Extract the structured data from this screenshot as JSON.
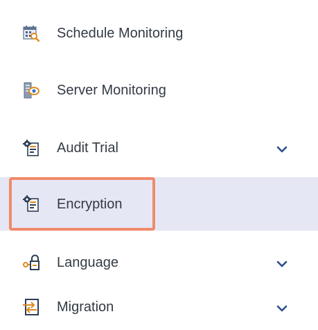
{
  "menu": {
    "items": [
      {
        "label": "Schedule Monitoring",
        "icon": "calendar-search-icon",
        "has_chevron": false,
        "selected": false
      },
      {
        "label": "Server Monitoring",
        "icon": "server-eye-icon",
        "has_chevron": false,
        "selected": false
      },
      {
        "label": "Audit Trial",
        "icon": "document-gear-icon",
        "has_chevron": true,
        "selected": false
      },
      {
        "label": "Encryption",
        "icon": "document-gear-icon",
        "has_chevron": false,
        "selected": true
      },
      {
        "label": "Language",
        "icon": "key-lock-icon",
        "has_chevron": true,
        "selected": false
      },
      {
        "label": "Migration",
        "icon": "migration-arrows-icon",
        "has_chevron": true,
        "selected": false
      }
    ]
  },
  "colors": {
    "text": "#333a44",
    "selected_background": "#e6e7f5",
    "highlight_border": "#f08a6a",
    "chevron": "#2b4e8c"
  }
}
